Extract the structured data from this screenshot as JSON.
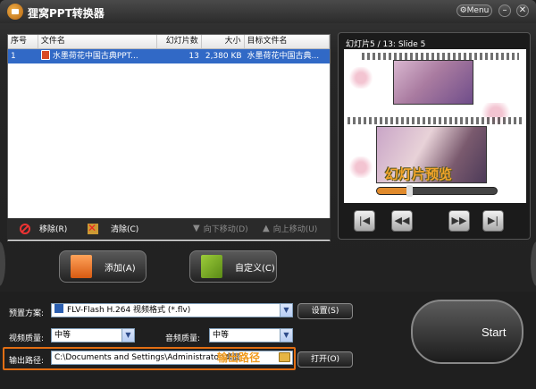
{
  "window": {
    "title": "狸窝PPT转换器",
    "menu_label": "Menu",
    "minimize": "–",
    "close": "✕"
  },
  "file_list": {
    "columns": [
      "序号",
      "文件名",
      "幻灯片数",
      "大小",
      "目标文件名"
    ],
    "rows": [
      {
        "index": "1",
        "name": "水墨荷花中国古典PPT...",
        "slides": "13",
        "size": "2,380 KB",
        "target": "水墨荷花中国古典..."
      }
    ]
  },
  "list_toolbar": {
    "remove": "移除(R)",
    "clear": "清除(C)",
    "move_down": "向下移动(D)",
    "move_up": "向上移动(U)"
  },
  "preview": {
    "label": "幻灯片5 / 13: Slide 5",
    "overlay_text": "幻灯片预览",
    "progress": 0.27
  },
  "actions": {
    "add": "添加(A)",
    "customize": "自定义(C)"
  },
  "settings": {
    "preset_label": "预置方案:",
    "preset_value": "FLV-Flash H.264 视频格式 (*.flv)",
    "settings_button": "设置(S)",
    "video_quality_label": "视频质量:",
    "video_quality_value": "中等",
    "audio_quality_label": "音频质量:",
    "audio_quality_value": "中等",
    "output_label": "输出路径:",
    "output_value": "C:\\Documents and Settings\\Administrator\\桌面",
    "output_annotation": "输出路径",
    "open_button": "打开(O)"
  },
  "start_label": "Start",
  "colors": {
    "accent": "#e26e13",
    "selection": "#3169c6",
    "overlay_text": "#f3a52a"
  }
}
